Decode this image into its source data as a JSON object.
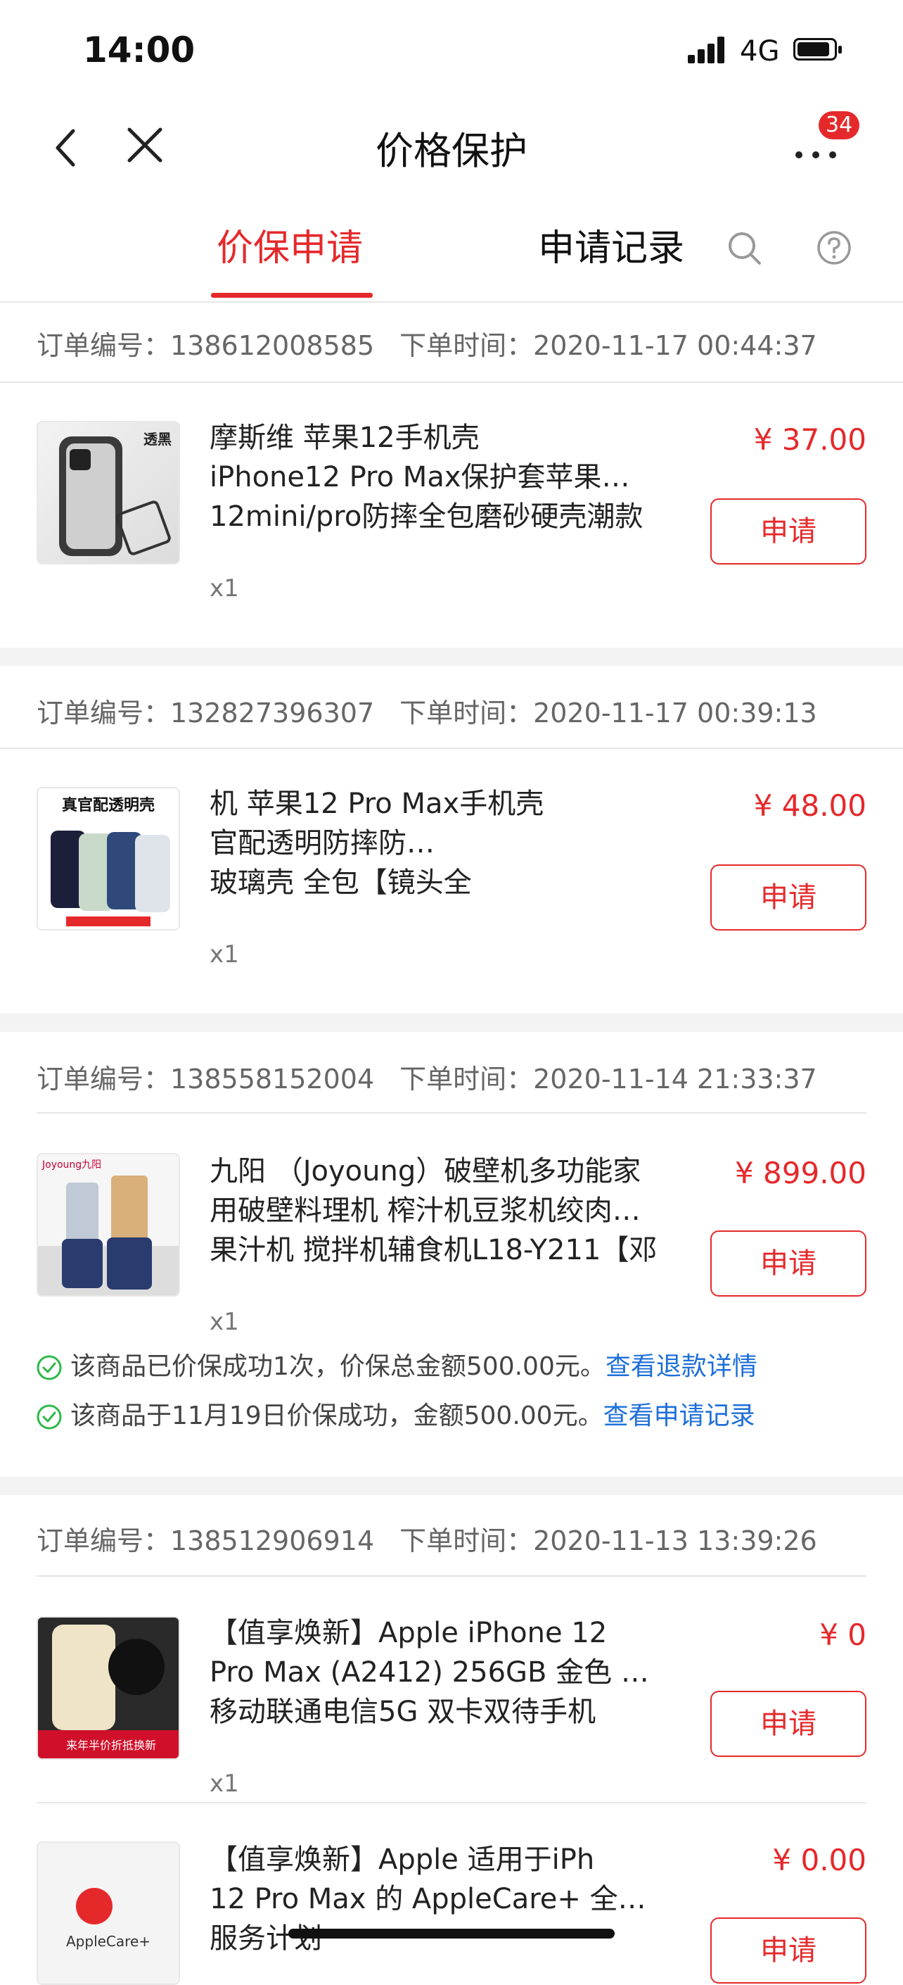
{
  "status_bar": {
    "time": "14:00",
    "network": "4G"
  },
  "nav": {
    "title": "价格保护",
    "badge_count": "34"
  },
  "tabs": [
    {
      "label": "价保申请"
    },
    {
      "label": "申请记录"
    }
  ],
  "orders": [
    {
      "order_no_label": "订单编号：138612008585",
      "order_time_label": "下单时间：2020-11-17 00:44:37",
      "name_lines": [
        "摩斯维 苹果12手机壳",
        "iPhone12 Pro Max保护套苹果…",
        "12mini/pro防摔全包磨砂硬壳潮款"
      ],
      "qty": "x1",
      "price": "¥ 37.00",
      "button": "申请",
      "thumb_text": "透黑"
    },
    {
      "order_no_label": "订单编号：132827396307",
      "order_time_label": "下单时间：2020-11-17 00:39:13",
      "name_lines": [
        "机 苹果12 Pro Max手机壳",
        "官配透明防摔防…",
        "玻璃壳 全包【镜头全"
      ],
      "qty": "x1",
      "price": "¥ 48.00",
      "button": "申请",
      "thumb_text": "真官配透明壳"
    },
    {
      "order_no_label": "订单编号：138558152004",
      "order_time_label": "下单时间：2020-11-14 21:33:37",
      "name_lines": [
        "九阳 （Joyoung）破壁机多功能家",
        "用破壁料理机 榨汁机豆浆机绞肉…",
        "果汁机 搅拌机辅食机L18-Y211【邓"
      ],
      "qty": "x1",
      "price": "¥ 899.00",
      "button": "申请",
      "thumb_text": "Joyoung九阳",
      "notes": [
        {
          "text": "该商品已价保成功1次，价保总金额500.00元。",
          "link": "查看退款详情"
        },
        {
          "text": "该商品于11月19日价保成功，金额500.00元。",
          "link": "查看申请记录"
        }
      ]
    },
    {
      "order_no_label": "订单编号：138512906914",
      "order_time_label": "下单时间：2020-11-13 13:39:26",
      "items": [
        {
          "name_lines": [
            "【值享焕新】Apple iPhone 12",
            "Pro Max (A2412) 256GB 金色 …",
            "移动联通电信5G 双卡双待手机"
          ],
          "qty": "x1",
          "price": "¥ 0",
          "button": "申请",
          "thumb_text": "来年半价折抵换新"
        },
        {
          "name_lines": [
            "【值享焕新】Apple 适用于iPh",
            "12 Pro Max 的 AppleCare+ 全方…",
            "服务计划"
          ],
          "price": "¥ 0.00",
          "button": "申请",
          "thumb_text": "AppleCare+"
        }
      ]
    }
  ],
  "colors": {
    "accent": "#e5292b",
    "link": "#1e6fd9",
    "success": "#2fb84a"
  }
}
